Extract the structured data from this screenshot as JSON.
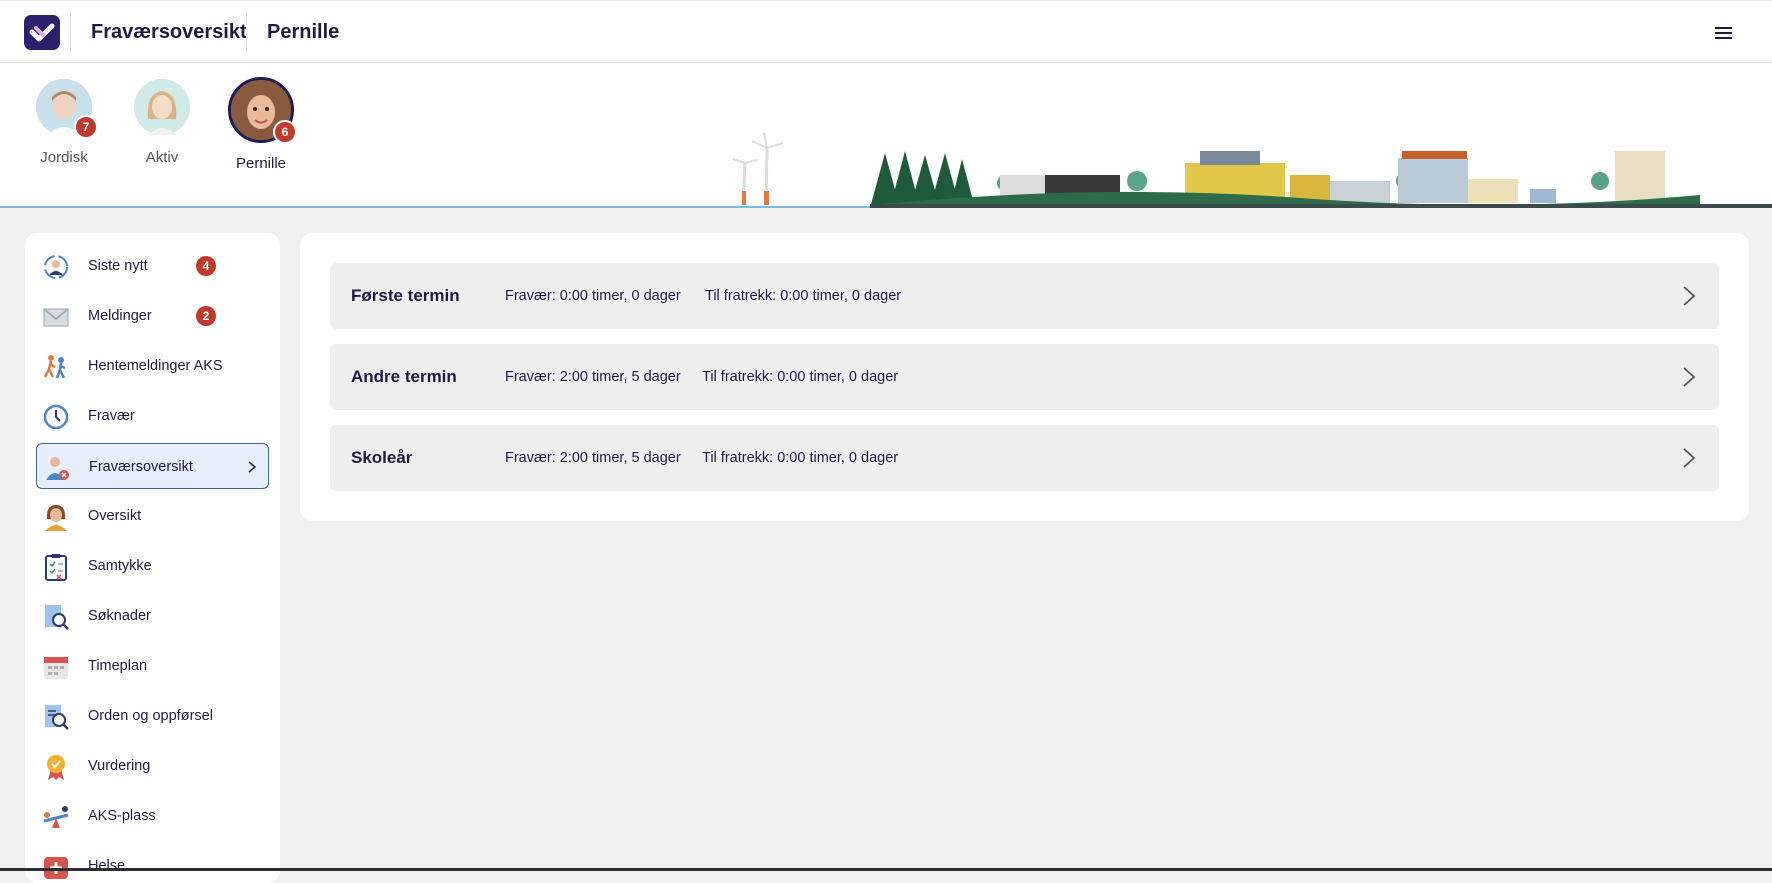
{
  "header": {
    "section_title": "Fraværsoversikt",
    "child_title": "Pernille"
  },
  "children": [
    {
      "name": "Jordisk",
      "badge": "7",
      "selected": false
    },
    {
      "name": "Aktiv",
      "badge": "",
      "selected": false
    },
    {
      "name": "Pernille",
      "badge": "6",
      "selected": true
    }
  ],
  "sidebar": {
    "items": [
      {
        "label": "Siste nytt",
        "icon": "news-icon",
        "badge": "4"
      },
      {
        "label": "Meldinger",
        "icon": "envelope-icon",
        "badge": "2"
      },
      {
        "label": "Hentemeldinger AKS",
        "icon": "walking-people-icon"
      },
      {
        "label": "Fravær",
        "icon": "clock-icon"
      },
      {
        "label": "Fraværsoversikt",
        "icon": "absence-person-icon",
        "active": true
      },
      {
        "label": "Oversikt",
        "icon": "student-icon"
      },
      {
        "label": "Samtykke",
        "icon": "clipboard-checklist-icon"
      },
      {
        "label": "Søknader",
        "icon": "document-search-icon"
      },
      {
        "label": "Timeplan",
        "icon": "calendar-icon"
      },
      {
        "label": "Orden og oppførsel",
        "icon": "conduct-search-icon"
      },
      {
        "label": "Vurdering",
        "icon": "award-medal-icon"
      },
      {
        "label": "AKS-plass",
        "icon": "seesaw-icon"
      },
      {
        "label": "Helse",
        "icon": "health-icon"
      }
    ]
  },
  "terms": [
    {
      "title": "Første termin",
      "absence": "Fravær: 0:00 timer, 0 dager",
      "deduction": "Til fratrekk: 0:00 timer, 0 dager"
    },
    {
      "title": "Andre termin",
      "absence": "Fravær: 2:00 timer, 5 dager",
      "deduction": "Til fratrekk: 0:00 timer, 0 dager"
    },
    {
      "title": "Skoleår",
      "absence": "Fravær: 2:00 timer, 5 dager",
      "deduction": "Til fratrekk: 0:00 timer, 0 dager"
    }
  ],
  "colors": {
    "brand": "#2c1f6e",
    "badge": "#c0392b",
    "active_bg": "#e6effc",
    "active_border": "#3a64b4",
    "text": "#1d1b44"
  }
}
